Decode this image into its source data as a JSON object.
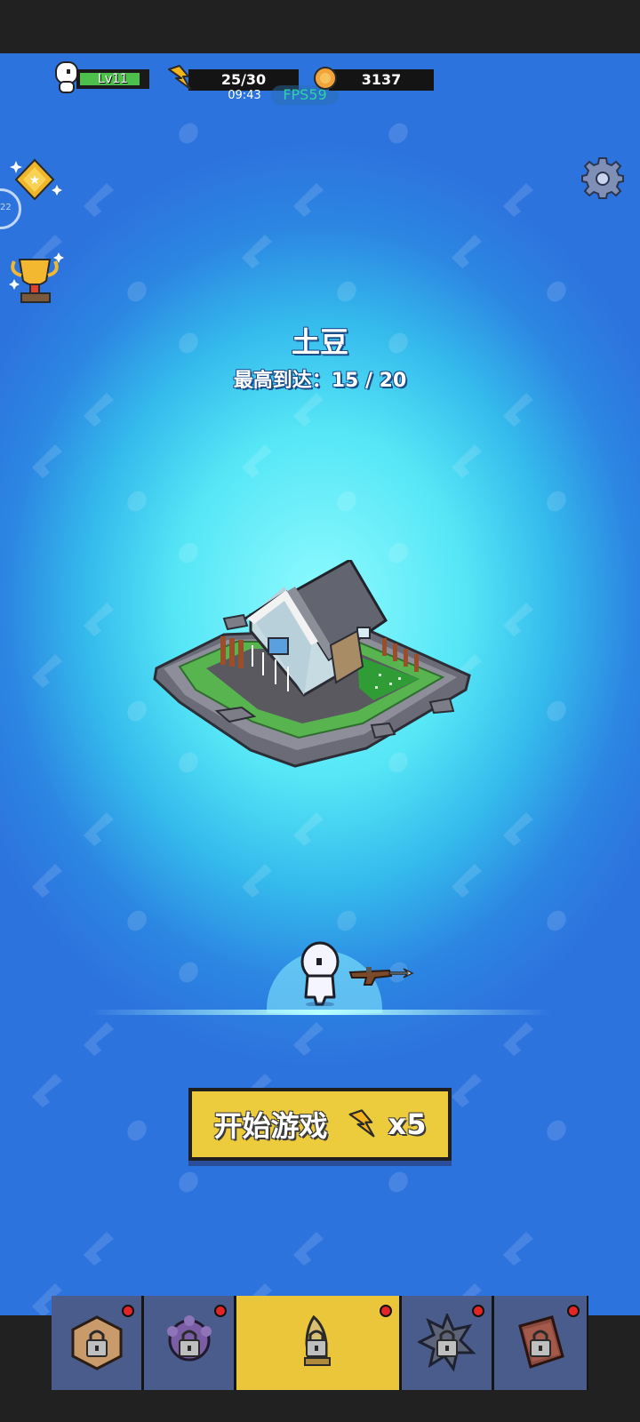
{
  "hud": {
    "level": "Lv11",
    "level_progress": 0.9,
    "energy": "25/30",
    "energy_timer": "09:43",
    "fps": "FPS59",
    "coins": "3137"
  },
  "side_menu": {
    "ring_text": "22",
    "icons": [
      "ticket-icon",
      "trophy-icon"
    ],
    "settings_icon": "gear-icon"
  },
  "stage": {
    "title": "土豆",
    "best_label": "最高到达：",
    "best_value": "15 / 20"
  },
  "start_button": {
    "label": "开始游戏",
    "cost": "x5",
    "icon": "lightning-icon"
  },
  "nav": {
    "tabs": [
      {
        "icon": "locked-crate-icon",
        "badge": true,
        "active": false
      },
      {
        "icon": "locked-orb-icon",
        "badge": true,
        "active": false
      },
      {
        "icon": "locked-bullet-icon",
        "badge": true,
        "active": true
      },
      {
        "icon": "locked-spiked-icon",
        "badge": true,
        "active": false
      },
      {
        "icon": "locked-book-icon",
        "badge": true,
        "active": false
      }
    ]
  },
  "colors": {
    "accent_yellow": "#ecc63a",
    "tab_blue": "#495c8b",
    "badge_red": "#e42525",
    "fps_green": "#2fd3a8"
  }
}
